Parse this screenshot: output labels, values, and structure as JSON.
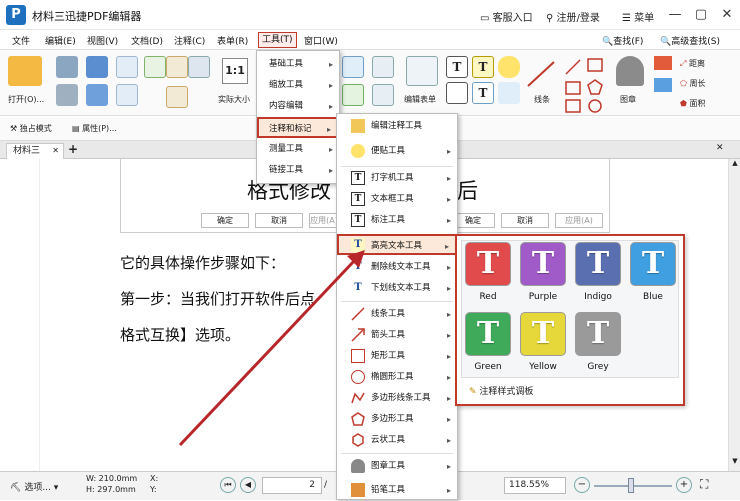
{
  "window": {
    "logo": "P",
    "title": "材料三迅捷PDF编辑器",
    "links": [
      "客服入口",
      "注册/登录",
      "菜单"
    ]
  },
  "menubar": [
    "文件",
    "编辑(E)",
    "视图(V)",
    "文档(D)",
    "注释(C)",
    "表单(R)",
    "工具(T)",
    "窗口(W)"
  ],
  "menubar_right": {
    "find": "查找(F)",
    "adv_find": "高级查找(S)"
  },
  "ribbon": {
    "open": "打开(O)...",
    "actual_size": "实际大小",
    "edit_form": "编辑表单",
    "line": "线条",
    "stamp": "图章",
    "distance": "距离",
    "perimeter": "周长",
    "area": "面积"
  },
  "sub_toolbar": {
    "exclusive_mode": "独占模式",
    "properties": "属性(P)..."
  },
  "tab": {
    "name": "材料三",
    "add": "+"
  },
  "document": {
    "dialog_title_left": "格式修改",
    "dialog_title_right": "后",
    "dialog_buttons": [
      "确定",
      "取消",
      "应用(A)"
    ],
    "dialog_buttons_right": [
      "确定",
      "取消",
      "应用(A)"
    ],
    "line1": "它的具体操作步骤如下：",
    "line2": "第一步：当我们打开软件后点",
    "line3": "格式互换】选项。"
  },
  "tools_menu": [
    "基础工具",
    "缩放工具",
    "内容编辑",
    "注释和标记",
    "测量工具",
    "链接工具"
  ],
  "annot_menu": [
    "编辑注释工具",
    "便贴工具",
    "打字机工具",
    "文本框工具",
    "标注工具",
    "高亮文本工具",
    "删除线文本工具",
    "下划线文本工具",
    "线条工具",
    "箭头工具",
    "矩形工具",
    "椭圆形工具",
    "多边形线条工具",
    "多边形工具",
    "云状工具",
    "图章工具",
    "铅笔工具"
  ],
  "highlight_colors": [
    {
      "name": "Red",
      "color": "#e24b4b"
    },
    {
      "name": "Purple",
      "color": "#a05bc8"
    },
    {
      "name": "Indigo",
      "color": "#5a6fb0"
    },
    {
      "name": "Blue",
      "color": "#3f9fe0"
    },
    {
      "name": "Green",
      "color": "#3faa5a"
    },
    {
      "name": "Yellow",
      "color": "#e6d83a"
    },
    {
      "name": "Grey",
      "color": "#9a9a9a"
    }
  ],
  "color_panel_footer": "注释样式调板",
  "statusbar": {
    "select": "选项...",
    "w": "W: 210.0mm",
    "h": "H: 297.0mm",
    "x": "X:",
    "y": "Y:",
    "page": "2",
    "zoom": "118.55%"
  },
  "accent": "#c0392b"
}
